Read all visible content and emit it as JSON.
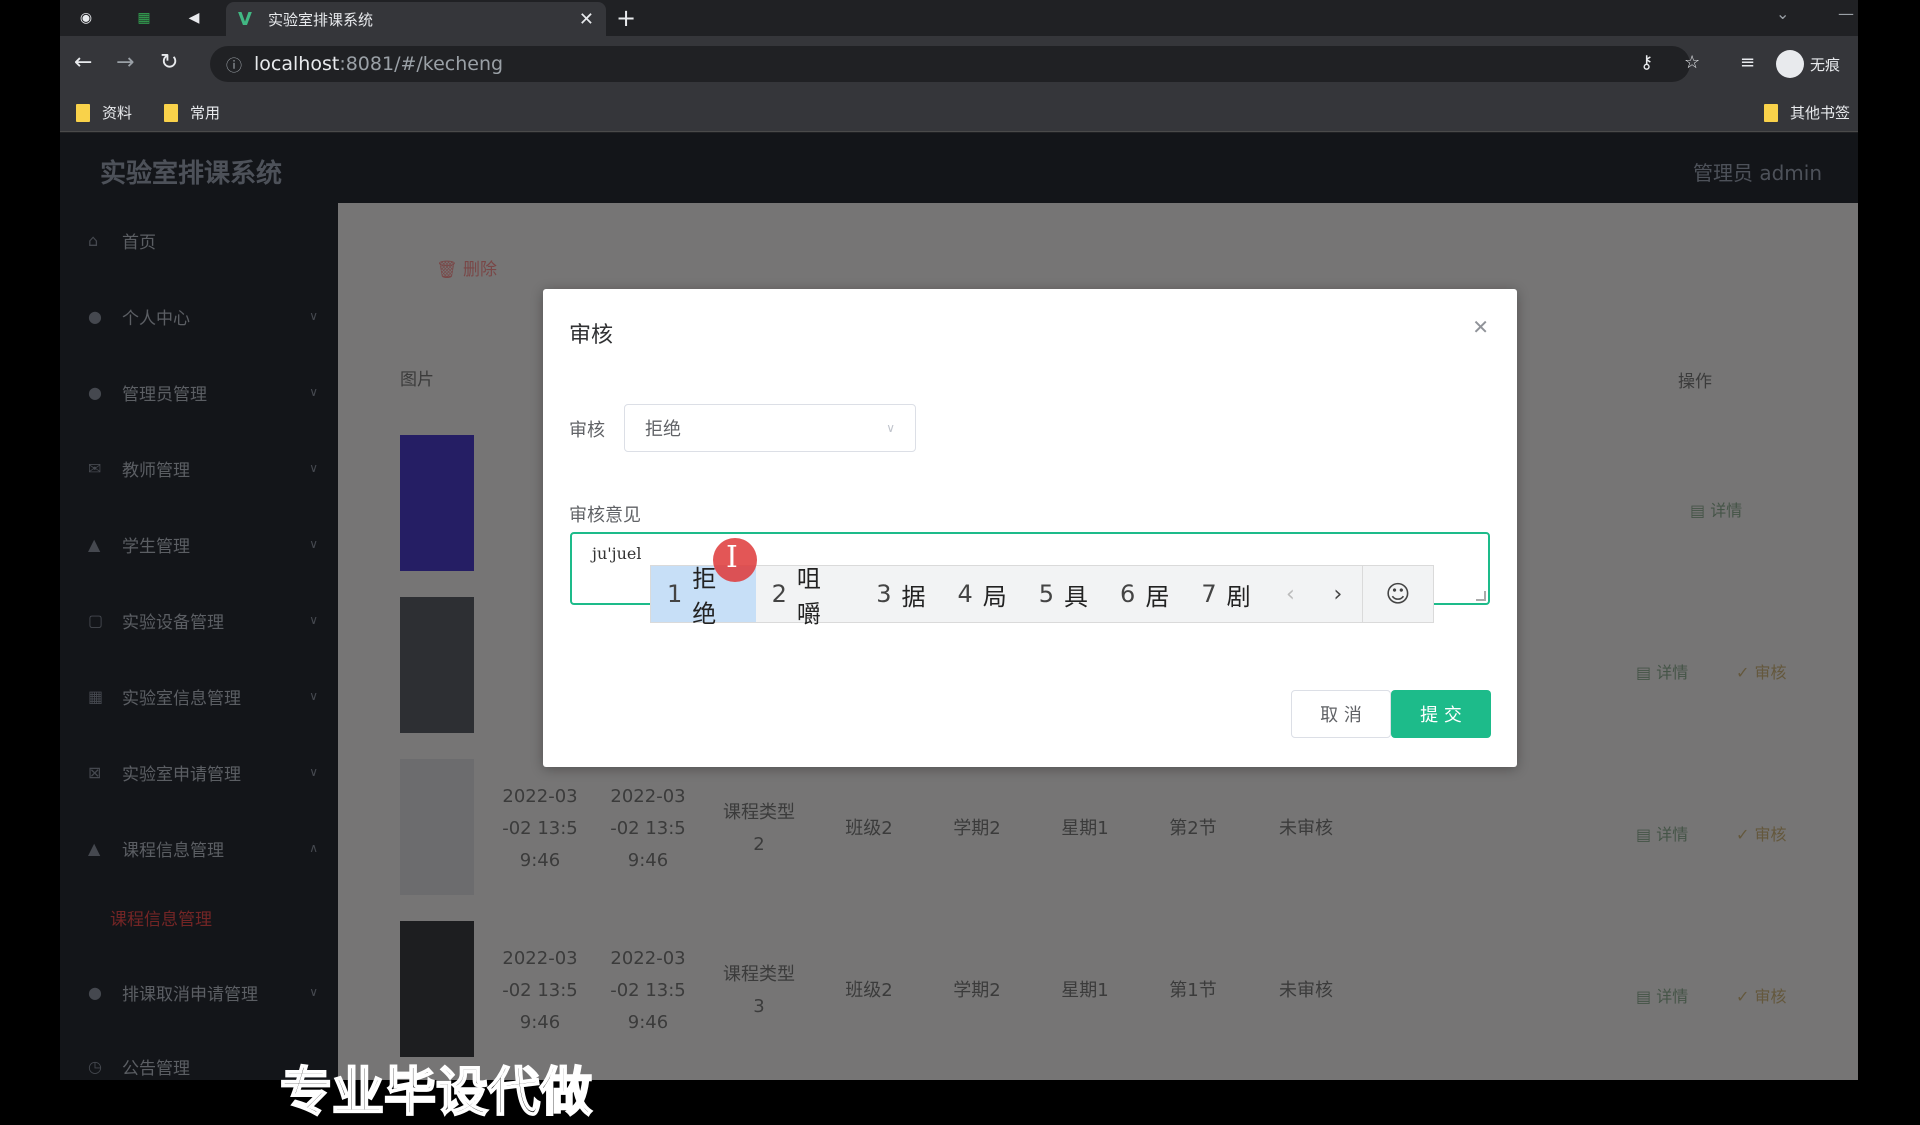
{
  "browser": {
    "tab_title": "实验室排课系统",
    "url_host": "localhost",
    "url_path": ":8081/#/kecheng",
    "bookmarks": [
      "资料",
      "常用"
    ],
    "other_bookmarks": "其他书签",
    "profile": "无痕"
  },
  "app": {
    "title": "实验室排课系统",
    "admin_label": "管理员 admin"
  },
  "sidebar": {
    "items": [
      {
        "label": "首页",
        "icon": "home-icon"
      },
      {
        "label": "个人中心",
        "icon": "user-icon"
      },
      {
        "label": "管理员管理",
        "icon": "user-icon"
      },
      {
        "label": "教师管理",
        "icon": "mail-icon"
      },
      {
        "label": "学生管理",
        "icon": "bank-icon"
      },
      {
        "label": "实验设备管理",
        "icon": "frame-icon"
      },
      {
        "label": "实验室信息管理",
        "icon": "grid-icon"
      },
      {
        "label": "实验室申请管理",
        "icon": "close-box-icon"
      },
      {
        "label": "课程信息管理",
        "icon": "bank-icon"
      },
      {
        "label": "排课取消申请管理",
        "icon": "user-icon"
      },
      {
        "label": "公告管理",
        "icon": "clock-icon"
      }
    ],
    "active_sub": "课程信息管理"
  },
  "content": {
    "delete_label": "删除",
    "col_image": "图片",
    "col_ops": "操作",
    "detail_label": "详情",
    "audit_label": "审核",
    "rows": [
      {
        "c1": "2022-03\n-02 13:5\n9:46",
        "c2": "2022-03\n-02 13:5\n9:46",
        "type": "课程类型\n2",
        "class": "班级2",
        "term": "学期2",
        "day": "星期1",
        "period": "第2节",
        "status": "未审核"
      },
      {
        "c1": "2022-03\n-02 13:5\n9:46",
        "c2": "2022-03\n-02 13:5\n9:46",
        "type": "课程类型\n3",
        "class": "班级2",
        "term": "学期2",
        "day": "星期1",
        "period": "第1节",
        "status": "未审核"
      }
    ]
  },
  "dialog": {
    "title": "审核",
    "audit_label": "审核",
    "audit_value": "拒绝",
    "comment_label": "审核意见",
    "typed_text": "ju'juel",
    "cancel_label": "取 消",
    "submit_label": "提 交"
  },
  "ime": {
    "candidates": [
      {
        "n": "1",
        "text": "拒绝"
      },
      {
        "n": "2",
        "text": "咀嚼"
      },
      {
        "n": "3",
        "text": "据"
      },
      {
        "n": "4",
        "text": "局"
      },
      {
        "n": "5",
        "text": "具"
      },
      {
        "n": "6",
        "text": "居"
      },
      {
        "n": "7",
        "text": "剧"
      }
    ]
  },
  "subtitle": "专业毕设代做",
  "colors": {
    "accent": "#1dbb8a",
    "sidebar": "#262a33",
    "danger": "#e64a4a"
  }
}
